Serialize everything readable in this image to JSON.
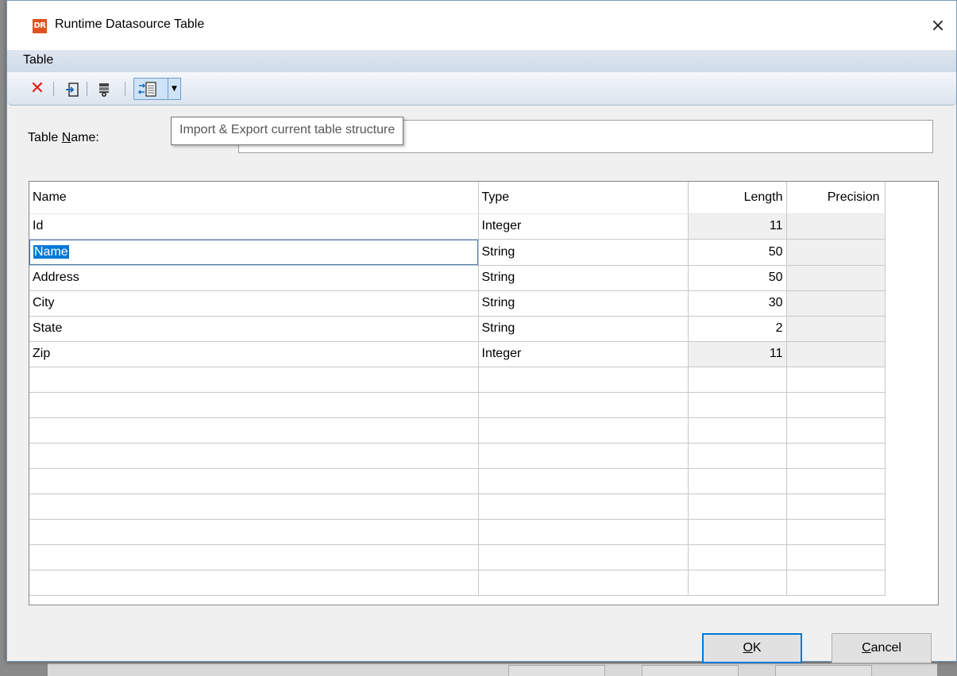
{
  "window": {
    "title": "Runtime Datasource Table",
    "icon_text": "DR",
    "close_glyph": "×"
  },
  "menu": {
    "items": [
      "Table"
    ]
  },
  "toolbar": {
    "icons": [
      "delete-icon",
      "import-icon",
      "view-structure-icon",
      "import-export-icon",
      "dropdown-arrow-icon"
    ],
    "tooltip": "Import & Export current table structure"
  },
  "form": {
    "table_name_label_pre": "Table ",
    "table_name_label_accel": "N",
    "table_name_label_post": "ame:",
    "table_name_value": ""
  },
  "grid": {
    "columns": [
      "Name",
      "Type",
      "Length",
      "Precision"
    ],
    "rows": [
      {
        "name": "Id",
        "type": "Integer",
        "length": "11",
        "precision": ""
      },
      {
        "name": "Name",
        "type": "String",
        "length": "50",
        "precision": ""
      },
      {
        "name": "Address",
        "type": "String",
        "length": "50",
        "precision": ""
      },
      {
        "name": "City",
        "type": "String",
        "length": "30",
        "precision": ""
      },
      {
        "name": "State",
        "type": "String",
        "length": "2",
        "precision": ""
      },
      {
        "name": "Zip",
        "type": "Integer",
        "length": "11",
        "precision": ""
      }
    ],
    "empty_rows": 9,
    "editing_row": 1
  },
  "buttons": {
    "ok_accel": "O",
    "ok_rest": "K",
    "cancel_accel": "C",
    "cancel_rest": "ancel"
  },
  "colors": {
    "accent": "#0078d7",
    "delete_red": "#e0201a",
    "app_icon": "#e0531f"
  }
}
